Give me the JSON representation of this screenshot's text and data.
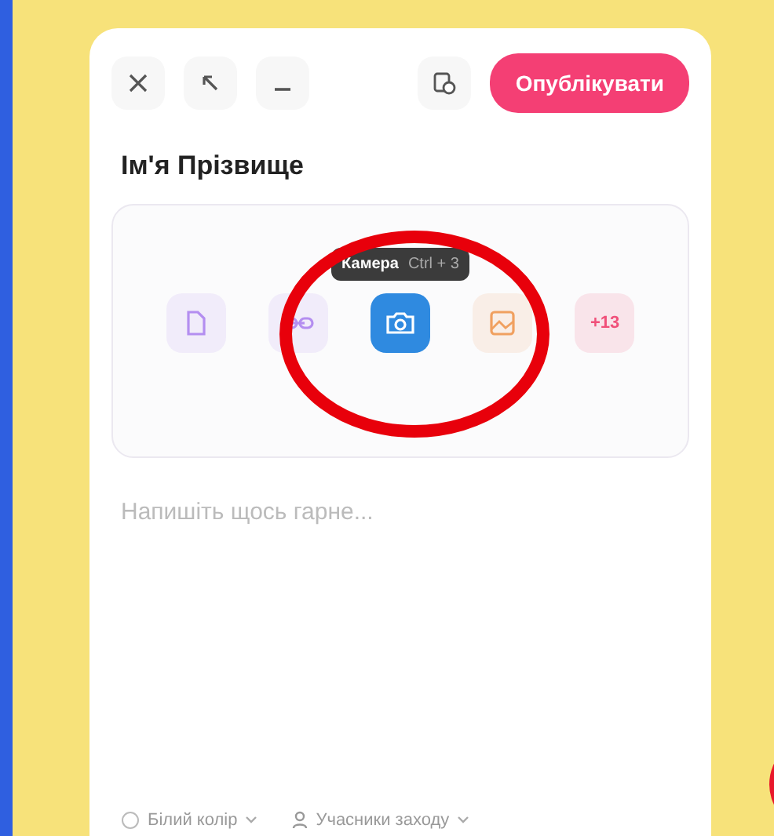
{
  "toolbar": {
    "publish_button": "Опублікувати"
  },
  "title": "Ім'я Прізвище",
  "media": {
    "tooltip": {
      "label": "Камера",
      "shortcut": "Ctrl + 3"
    },
    "items": [
      {
        "kind": "file",
        "color": "#b48ef0",
        "selected": false
      },
      {
        "kind": "link",
        "color": "#b48ef0",
        "selected": false
      },
      {
        "kind": "camera",
        "color": "#2f8ae0",
        "selected": true
      },
      {
        "kind": "image",
        "color": "#f0a060",
        "selected": false
      },
      {
        "kind": "more",
        "color": "#f0507a",
        "selected": false,
        "label": "+13"
      }
    ]
  },
  "editor": {
    "placeholder": "Напишіть щось гарне..."
  },
  "footer": [
    {
      "kind": "color",
      "label": "Білий колір"
    },
    {
      "kind": "audience",
      "label": "Учасники заходу"
    }
  ]
}
